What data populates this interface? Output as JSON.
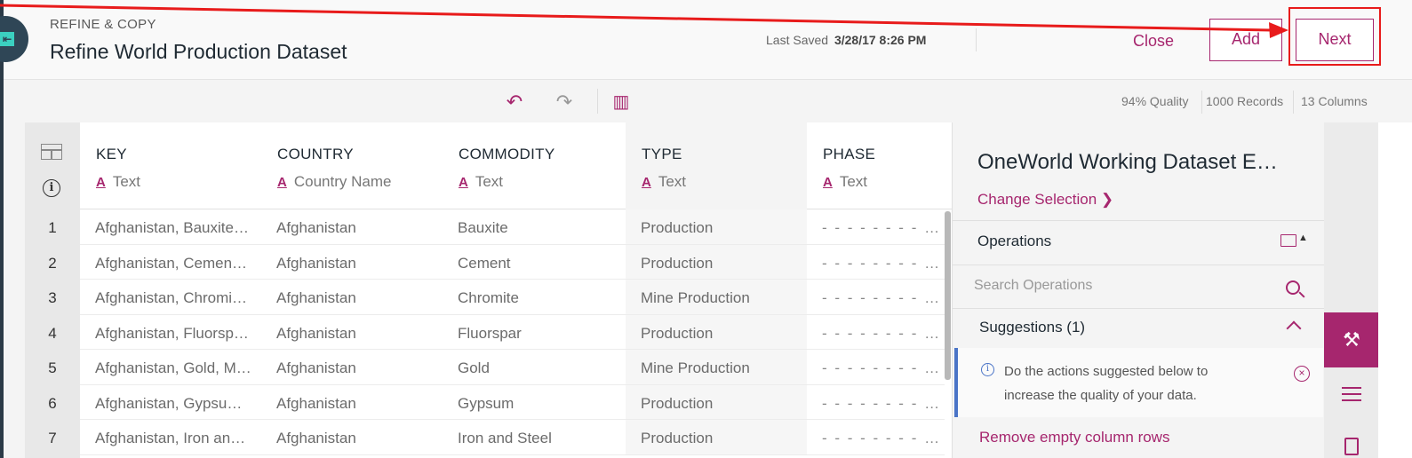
{
  "header": {
    "breadcrumb": "REFINE & COPY",
    "title": "Refine World Production Dataset",
    "last_saved_label": "Last Saved",
    "last_saved_value": "3/28/17 8:26 PM",
    "close_label": "Close",
    "add_label": "Add",
    "next_label": "Next"
  },
  "toolbar": {
    "icons": [
      "undo-icon",
      "redo-icon",
      "bar-chart-icon"
    ],
    "quality": "94% Quality",
    "records": "1000 Records",
    "columns": "13 Columns"
  },
  "grid": {
    "columns": [
      {
        "name": "KEY",
        "type": "Text"
      },
      {
        "name": "COUNTRY",
        "type": "Country Name"
      },
      {
        "name": "COMMODITY",
        "type": "Text"
      },
      {
        "name": "TYPE",
        "type": "Text"
      },
      {
        "name": "PHASE",
        "type": "Text"
      }
    ],
    "rows": [
      {
        "n": "1",
        "key": "Afghanistan, Bauxite…",
        "country": "Afghanistan",
        "commodity": "Bauxite",
        "type": "Production",
        "phase": "- - - - - - - - - - - -"
      },
      {
        "n": "2",
        "key": "Afghanistan, Cemen…",
        "country": "Afghanistan",
        "commodity": "Cement",
        "type": "Production",
        "phase": "- - - - - - - - - - - -"
      },
      {
        "n": "3",
        "key": "Afghanistan, Chromi…",
        "country": "Afghanistan",
        "commodity": "Chromite",
        "type": "Mine Production",
        "phase": "- - - - - - - - - - - -"
      },
      {
        "n": "4",
        "key": "Afghanistan, Fluorsp…",
        "country": "Afghanistan",
        "commodity": "Fluorspar",
        "type": "Production",
        "phase": "- - - - - - - - - - - -"
      },
      {
        "n": "5",
        "key": "Afghanistan, Gold, M…",
        "country": "Afghanistan",
        "commodity": "Gold",
        "type": "Mine Production",
        "phase": "- - - - - - - - - - - -"
      },
      {
        "n": "6",
        "key": "Afghanistan, Gypsu…",
        "country": "Afghanistan",
        "commodity": "Gypsum",
        "type": "Production",
        "phase": "- - - - - - - - - - - -"
      },
      {
        "n": "7",
        "key": "Afghanistan, Iron an…",
        "country": "Afghanistan",
        "commodity": "Iron and Steel",
        "type": "Production",
        "phase": "- - - - - - - - - - - -"
      }
    ]
  },
  "panel": {
    "title": "OneWorld Working Dataset E…",
    "change_selection": "Change Selection ❯",
    "operations_label": "Operations",
    "search_placeholder": "Search Operations",
    "suggestions_label": "Suggestions (1)",
    "suggestion_text": "Do the actions suggested below to increase the quality of your data.",
    "remove_link": "Remove empty column rows"
  },
  "colors": {
    "accent": "#a6266e",
    "annotation": "#e81b1b",
    "info": "#4a74c7"
  }
}
